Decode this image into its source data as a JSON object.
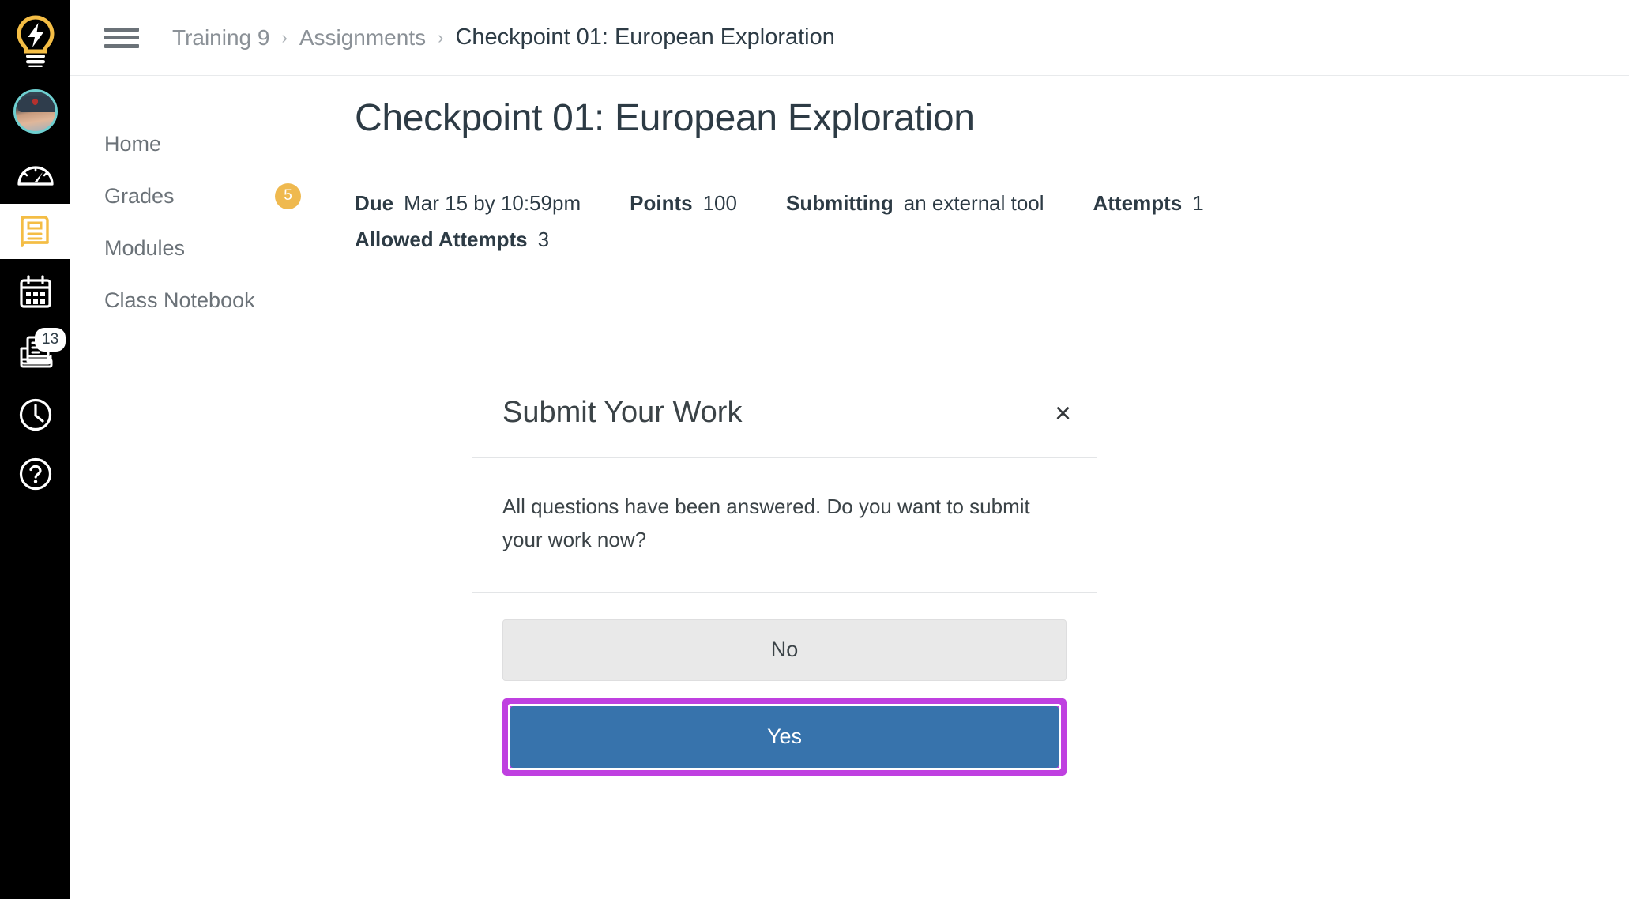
{
  "global_nav": {
    "items": [
      {
        "name": "logo",
        "icon": "lightbulb-icon",
        "label": "Dashboard Home Logo",
        "badge": null,
        "active": false
      },
      {
        "name": "account",
        "icon": "avatar-icon",
        "label": "Account",
        "badge": null,
        "active": false
      },
      {
        "name": "dashboard",
        "icon": "dashboard-gauge-icon",
        "label": "Dashboard",
        "badge": null,
        "active": false
      },
      {
        "name": "courses",
        "icon": "book-icon",
        "label": "Courses",
        "badge": null,
        "active": true
      },
      {
        "name": "calendar",
        "icon": "calendar-icon",
        "label": "Calendar",
        "badge": null,
        "active": false
      },
      {
        "name": "inbox",
        "icon": "inbox-icon",
        "label": "Inbox",
        "badge": "13",
        "active": false
      },
      {
        "name": "history",
        "icon": "clock-icon",
        "label": "History",
        "badge": null,
        "active": false
      },
      {
        "name": "help",
        "icon": "question-circle-icon",
        "label": "Help",
        "badge": null,
        "active": false
      }
    ]
  },
  "breadcrumb": {
    "menu_label": "Menu",
    "separator": "›",
    "items": [
      {
        "label": "Training 9",
        "current": false
      },
      {
        "label": "Assignments",
        "current": false
      },
      {
        "label": "Checkpoint 01: European Exploration",
        "current": true
      }
    ]
  },
  "course_nav": {
    "items": [
      {
        "label": "Home",
        "badge": null
      },
      {
        "label": "Grades",
        "badge": "5"
      },
      {
        "label": "Modules",
        "badge": null
      },
      {
        "label": "Class Notebook",
        "badge": null
      }
    ]
  },
  "assignment": {
    "title": "Checkpoint 01: European Exploration",
    "details": [
      {
        "term": "Due",
        "value": "Mar 15 by 10:59pm"
      },
      {
        "term": "Points",
        "value": "100"
      },
      {
        "term": "Submitting",
        "value": "an external tool"
      },
      {
        "term": "Attempts",
        "value": "1"
      }
    ],
    "details_second_row": [
      {
        "term": "Allowed Attempts",
        "value": "3"
      }
    ]
  },
  "modal": {
    "title": "Submit Your Work",
    "close_label": "×",
    "message": "All questions have been answered. Do you want to submit your work now?",
    "buttons": {
      "no": "No",
      "yes": "Yes"
    }
  },
  "colors": {
    "nav_background": "#000000",
    "brand_gold": "#efb94f",
    "primary_blue": "#3773ac",
    "highlight_magenta": "#bf40e0",
    "text_dark": "#2d3b45",
    "text_muted": "#6b7278",
    "avatar_ring": "#6ecfd0"
  }
}
